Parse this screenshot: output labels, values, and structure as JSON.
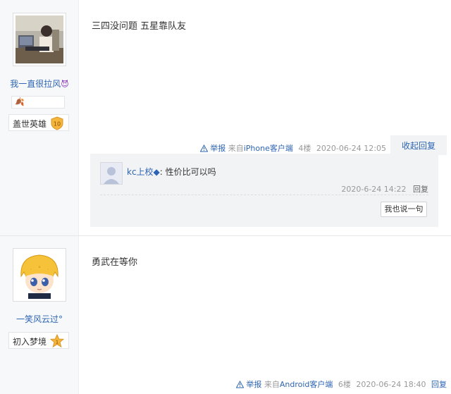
{
  "posts": [
    {
      "username": "我一直很拉风",
      "username_suffix": "😈",
      "badge_icon": "🍂",
      "level_title": "盖世英雄",
      "level_num": "10",
      "content": "三四没问题 五星靠队友",
      "meta": {
        "report": "举报",
        "from_prefix": "来自",
        "client": "iPhone客户端",
        "floor": "4楼",
        "datetime": "2020-06-24 12:05",
        "collapse": "收起回复"
      },
      "reply": {
        "user": "kc上校◆",
        "text": ": 性价比可以吗",
        "datetime": "2020-6-24 14:22",
        "reply_btn": "回复",
        "say_btn": "我也说一句"
      }
    },
    {
      "username": "一笑风云过",
      "username_suffix": "°",
      "level_title": "初入梦境",
      "level_num": "1",
      "content": "勇武在等你",
      "meta": {
        "report": "举报",
        "from_prefix": "来自",
        "client": "Android客户端",
        "floor": "6楼",
        "datetime": "2020-06-24 18:40",
        "reply_btn": "回复"
      }
    }
  ],
  "colors": {
    "link": "#2d64b3",
    "meta": "#999999",
    "sidebar_bg": "#f7f8fa",
    "reply_bg": "#f2f3f5"
  }
}
